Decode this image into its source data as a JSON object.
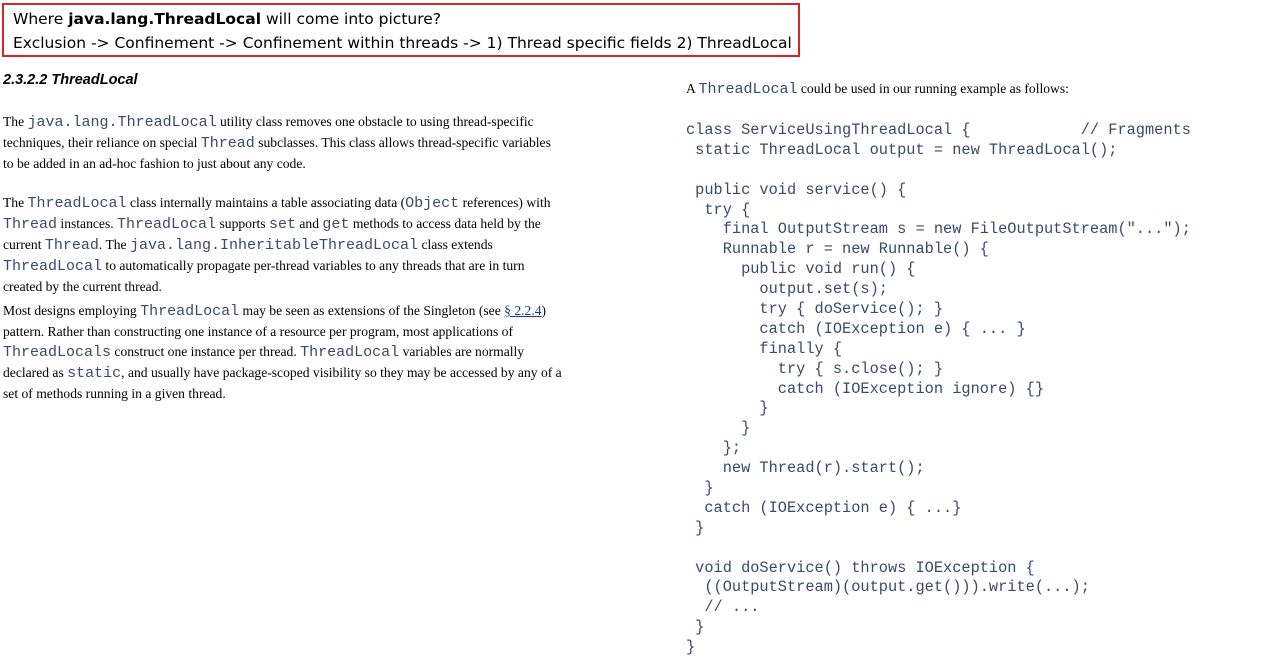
{
  "callout": {
    "line1_prefix": "Where ",
    "line1_bold": "java.lang.ThreadLocal",
    "line1_suffix": " will come into picture?",
    "line2": "Exclusion -> Confinement -> Confinement within threads -> 1) Thread specific fields 2) ThreadLocal"
  },
  "heading": "2.3.2.2 ThreadLocal",
  "para1": {
    "l1a": "The ",
    "l1code": "java.lang.ThreadLocal",
    "l1b": " utility class removes one obstacle to using thread-specific",
    "l2a": "techniques, their reliance on special ",
    "l2code": "Thread",
    "l2b": " subclasses. This class allows thread-specific variables",
    "l3": "to be added in an ad-hoc fashion to just about any code."
  },
  "para2": {
    "l1a": "The ",
    "l1code1": "ThreadLocal",
    "l1b": " class internally maintains a table associating data (",
    "l1code2": "Object",
    "l1c": " references) with",
    "l2code1": "Thread",
    "l2a": " instances. ",
    "l2code2": "ThreadLocal",
    "l2b": " supports ",
    "l2code3": "set",
    "l2c": " and ",
    "l2code4": "get",
    "l2d": " methods to access data held by the",
    "l3a": "current ",
    "l3code1": "Thread",
    "l3b": ". The ",
    "l3code2": "java.lang.InheritableThreadLocal",
    "l3c": " class extends",
    "l4code": "ThreadLocal",
    "l4a": " to automatically propagate per-thread variables to any threads that are in turn",
    "l5": "created by the current thread."
  },
  "para3": {
    "l1a": "Most designs employing ",
    "l1code": "ThreadLocal",
    "l1b": " may be seen as extensions of the Singleton (see ",
    "l1link": "§ 2.2.4",
    "l1c": ")",
    "l2": "pattern. Rather than constructing one instance of a resource per program, most applications of",
    "l3code1": "ThreadLocals",
    "l3a": " construct one instance per thread. ",
    "l3code2": "ThreadLocal",
    "l3b": " variables are normally",
    "l4a": "declared as ",
    "l4code": "static",
    "l4b": ", and usually have package-scoped visibility so they may be accessed by any of a",
    "l5": "set of methods running in a given thread."
  },
  "right_intro": {
    "a": "A ",
    "code": "ThreadLocal",
    "b": " could be used in our running example as follows:"
  },
  "code_lines": [
    "class ServiceUsingThreadLocal {            // Fragments",
    " static ThreadLocal output = new ThreadLocal();",
    "",
    " public void service() {",
    "  try {",
    "    final OutputStream s = new FileOutputStream(\"...\");",
    "    Runnable r = new Runnable() {",
    "      public void run() {",
    "        output.set(s);",
    "        try { doService(); }",
    "        catch (IOException e) { ... }",
    "        finally {",
    "          try { s.close(); }",
    "          catch (IOException ignore) {}",
    "        }",
    "      }",
    "    };",
    "    new Thread(r).start();",
    "  }",
    "  catch (IOException e) { ...}",
    " }",
    "",
    " void doService() throws IOException {",
    "  ((OutputStream)(output.get())).write(...);",
    "  // ...",
    " }",
    "}"
  ]
}
